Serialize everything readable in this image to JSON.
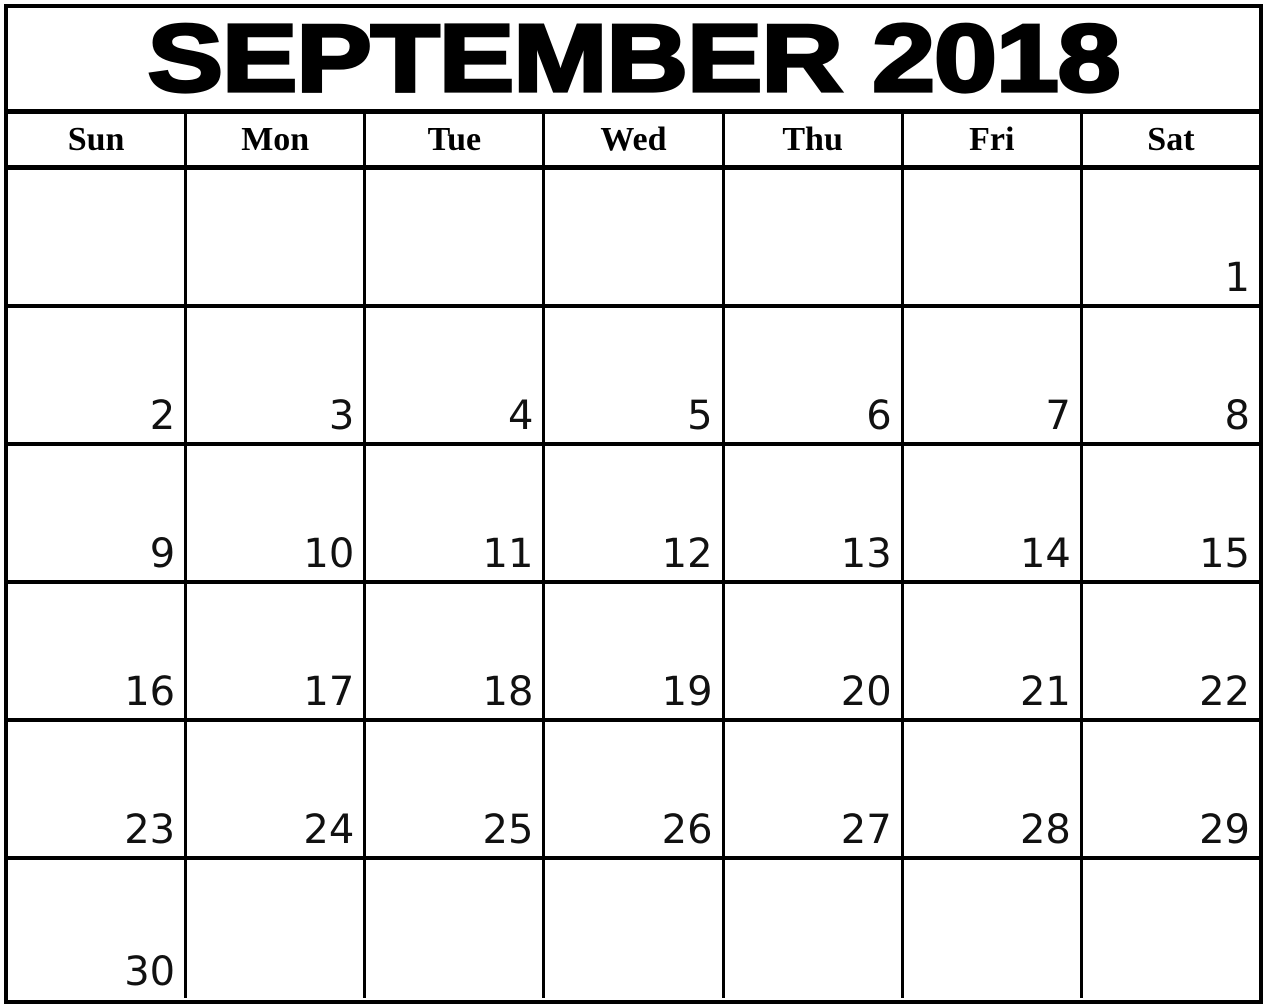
{
  "calendar": {
    "title": "SEPTEMBER 2018",
    "month": "SEPTEMBER",
    "year": "2018",
    "weekday_headers": [
      {
        "label": "Sun"
      },
      {
        "label": "Mon"
      },
      {
        "label": "Tue"
      },
      {
        "label": "Wed"
      },
      {
        "label": "Thu"
      },
      {
        "label": "Fri"
      },
      {
        "label": "Sat"
      }
    ],
    "weeks": [
      {
        "days": [
          {
            "date": ""
          },
          {
            "date": ""
          },
          {
            "date": ""
          },
          {
            "date": ""
          },
          {
            "date": ""
          },
          {
            "date": ""
          },
          {
            "date": "1"
          }
        ]
      },
      {
        "days": [
          {
            "date": "2"
          },
          {
            "date": "3"
          },
          {
            "date": "4"
          },
          {
            "date": "5"
          },
          {
            "date": "6"
          },
          {
            "date": "7"
          },
          {
            "date": "8"
          }
        ]
      },
      {
        "days": [
          {
            "date": "9"
          },
          {
            "date": "10"
          },
          {
            "date": "11"
          },
          {
            "date": "12"
          },
          {
            "date": "13"
          },
          {
            "date": "14"
          },
          {
            "date": "15"
          }
        ]
      },
      {
        "days": [
          {
            "date": "16"
          },
          {
            "date": "17"
          },
          {
            "date": "18"
          },
          {
            "date": "19"
          },
          {
            "date": "20"
          },
          {
            "date": "21"
          },
          {
            "date": "22"
          }
        ]
      },
      {
        "days": [
          {
            "date": "23"
          },
          {
            "date": "24"
          },
          {
            "date": "25"
          },
          {
            "date": "26"
          },
          {
            "date": "27"
          },
          {
            "date": "28"
          },
          {
            "date": "29"
          }
        ]
      },
      {
        "days": [
          {
            "date": "30"
          },
          {
            "date": ""
          },
          {
            "date": ""
          },
          {
            "date": ""
          },
          {
            "date": ""
          },
          {
            "date": ""
          },
          {
            "date": ""
          }
        ]
      }
    ]
  },
  "colors": {
    "border": "#000000",
    "background": "#ffffff",
    "text": "#000000",
    "date_text": "#111111"
  }
}
